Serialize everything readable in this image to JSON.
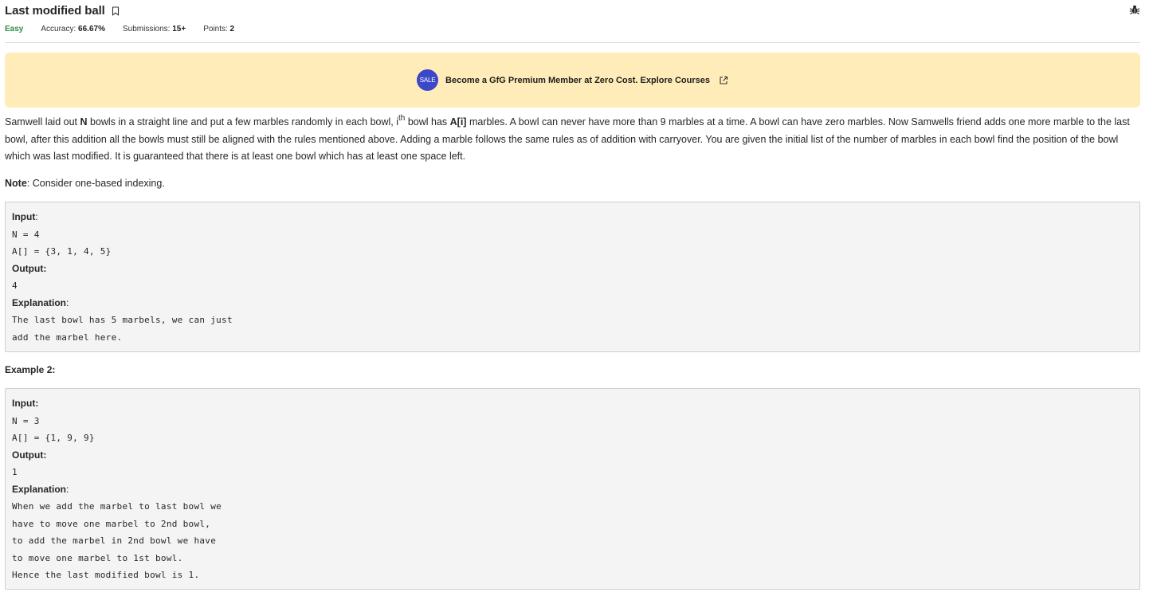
{
  "header": {
    "title": "Last modified ball",
    "difficulty": "Easy",
    "accuracy_label": "Accuracy:",
    "accuracy_value": "66.67%",
    "submissions_label": "Submissions:",
    "submissions_value": "15+",
    "points_label": "Points:",
    "points_value": "2"
  },
  "banner": {
    "badge": "SALE",
    "text": "Become a GfG Premium Member at Zero Cost. Explore Courses"
  },
  "problem": {
    "p1_a": "Samwell laid out ",
    "p1_n": "N",
    "p1_b": " bowls in a straight line and put a few marbles randomly in each bowl, i",
    "p1_sup": "th",
    "p1_c": " bowl has ",
    "p1_ai": "A[i]",
    "p1_d": " marbles. A bowl can never have more than 9 marbles at a time. A bowl can have zero marbles. Now Samwells friend adds one more marble to the last bowl, after this addition all the bowls must still be aligned with the rules mentioned above. Adding a marble follows the same rules as of addition with carryover. You are given the initial list of the number of marbles in each bowl find the position of the bowl which was last modified. It is guaranteed that there is at least one bowl which has at least one space left.",
    "note_label": "Note",
    "note_text": ": Consider one-based indexing."
  },
  "example1": {
    "input_label": "Input",
    "lines_in": [
      "N = 4",
      "A[] = {3, 1, 4, 5}"
    ],
    "output_label": "Output:",
    "output": "4",
    "explanation_label": "Explanation",
    "explanation": [
      "The last bowl has 5 marbels, we can just",
      "add the marbel here."
    ]
  },
  "example2_heading": "Example 2:",
  "example2": {
    "input_label": "Input:",
    "lines_in": [
      "N = 3",
      "A[] = {1, 9, 9}"
    ],
    "output_label": "Output:",
    "output": "1",
    "explanation_label": "Explanation",
    "explanation": [
      "When we add the marbel to last bowl we",
      "have to move one marbel to 2nd bowl,",
      "to add the marbel in 2nd bowl we have",
      "to move one marbel to 1st bowl.",
      "Hence the last modified bowl is 1."
    ]
  },
  "icons": {
    "bookmark": "bookmark-icon",
    "bug": "bug-icon",
    "external_link": "external-link-icon"
  },
  "colors": {
    "difficulty_easy": "#2f8d46",
    "banner_bg": "#ffecb8",
    "sale_badge": "#3c48c8"
  }
}
